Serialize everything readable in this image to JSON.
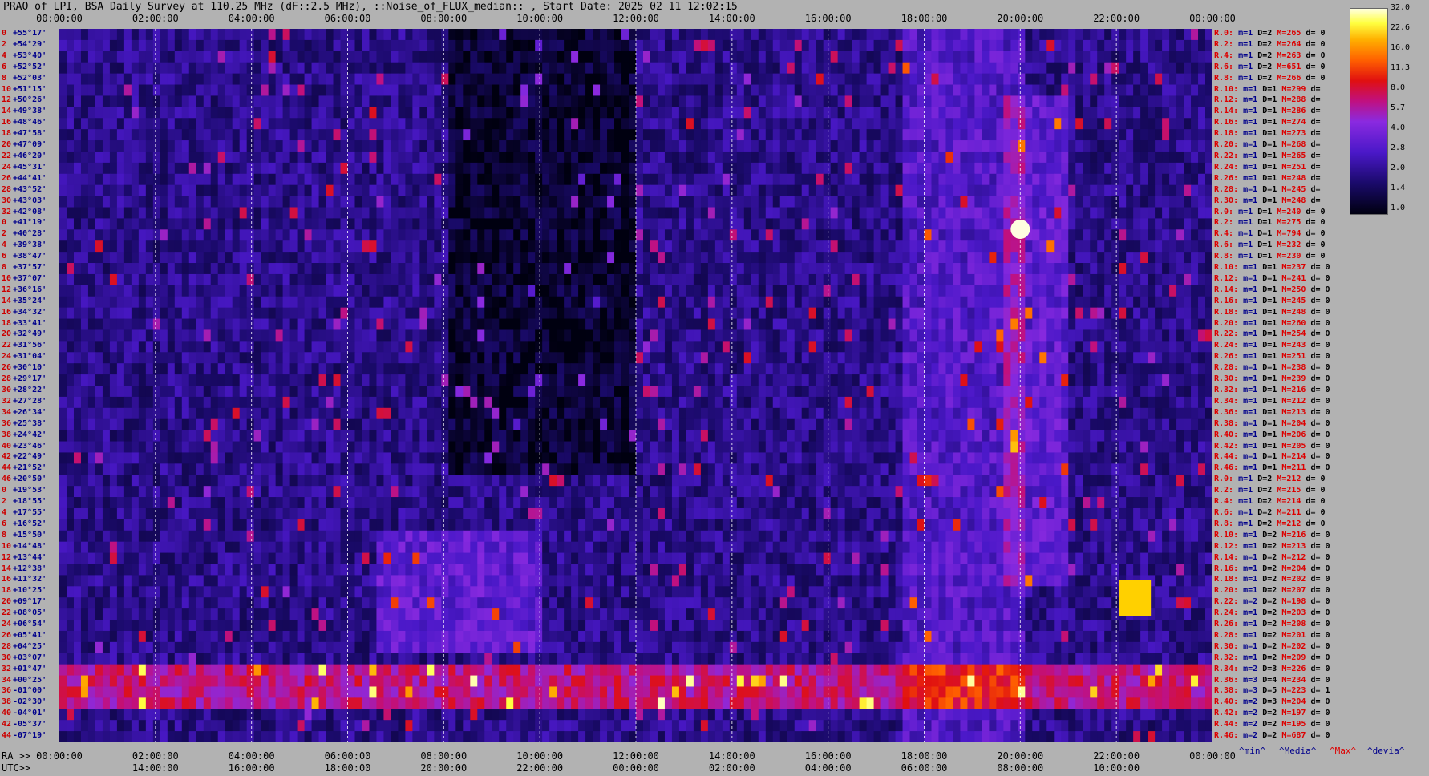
{
  "title": "PRAO of LPI, BSA Daily Survey at 110.25 MHz (dF::2.5 MHz), ::Noise_of_FLUX_median:: , Start Date: 2025 02 11 12:02:15",
  "top_axis": [
    "00:00:00",
    "02:00:00",
    "04:00:00",
    "06:00:00",
    "08:00:00",
    "10:00:00",
    "12:00:00",
    "14:00:00",
    "16:00:00",
    "18:00:00",
    "20:00:00",
    "22:00:00",
    "00:00:00"
  ],
  "bottom_ra_prefix": "RA >>",
  "bottom_ra": [
    "00:00:00",
    "02:00:00",
    "04:00:00",
    "06:00:00",
    "08:00:00",
    "10:00:00",
    "12:00:00",
    "14:00:00",
    "16:00:00",
    "18:00:00",
    "20:00:00",
    "22:00:00",
    "00:00:00"
  ],
  "bottom_utc_prefix": "UTC>>",
  "bottom_utc": [
    "14:00:00",
    "16:00:00",
    "18:00:00",
    "20:00:00",
    "22:00:00",
    "00:00:00",
    "02:00:00",
    "04:00:00",
    "06:00:00",
    "08:00:00",
    "10:00:00"
  ],
  "colorbar_ticks": [
    "32.0",
    "22.6",
    "16.0",
    "11.3",
    "8.0",
    "5.7",
    "4.0",
    "2.8",
    "2.0",
    "1.4",
    "1.0"
  ],
  "legend": {
    "min": "^min^",
    "media": "^Media^",
    "max": "^Max^",
    "devia": "^devia^"
  },
  "colors": {
    "background": "#b2b2b2",
    "label_red": "#dd0000",
    "label_blue": "#00008b"
  },
  "chart_data": {
    "type": "heatmap",
    "title": "PRAO of LPI, BSA Daily Survey at 110.25 MHz (dF::2.5 MHz), ::Noise_of_FLUX_median:: , Start Date: 2025 02 11 12:02:15",
    "x_axis_top": "local time",
    "x_range_hours": [
      0,
      24
    ],
    "color_scale_range": [
      1.0,
      32.0
    ],
    "declinations": [
      "+55°17'",
      "+54°29'",
      "+53°40'",
      "+52°52'",
      "+52°03'",
      "+51°15'",
      "+50°26'",
      "+49°38'",
      "+48°46'",
      "+47°58'",
      "+47°09'",
      "+46°20'",
      "+45°31'",
      "+44°41'",
      "+43°52'",
      "+43°03'",
      "+42°08'",
      "+41°19'",
      "+40°28'",
      "+39°38'",
      "+38°47'",
      "+37°57'",
      "+37°07'",
      "+36°16'",
      "+35°24'",
      "+34°32'",
      "+33°41'",
      "+32°49'",
      "+31°56'",
      "+31°04'",
      "+30°10'",
      "+29°17'",
      "+28°22'",
      "+27°28'",
      "+26°34'",
      "+25°38'",
      "+24°42'",
      "+23°46'",
      "+22°49'",
      "+21°52'",
      "+20°50'",
      "+19°53'",
      "+18°55'",
      "+17°55'",
      "+16°52'",
      "+15°50'",
      "+14°48'",
      "+13°44'",
      "+12°38'",
      "+11°32'",
      "+10°25'",
      "+09°17'",
      "+08°05'",
      "+06°54'",
      "+05°41'",
      "+04°25'",
      "+03°07'",
      "+01°47'",
      "+00°25'",
      "-01°00'",
      "-02°30'",
      "-04°01'",
      "-05°37'",
      "-07°19'"
    ],
    "row_index": [
      "0",
      "2",
      "4",
      "6",
      "8",
      "10",
      "12",
      "14",
      "16",
      "18",
      "20",
      "22",
      "24",
      "26",
      "28",
      "30",
      "32",
      "0",
      "2",
      "4",
      "6",
      "8",
      "10",
      "12",
      "14",
      "16",
      "18",
      "20",
      "22",
      "24",
      "26",
      "28",
      "30",
      "32",
      "34",
      "36",
      "38",
      "40",
      "42",
      "44",
      "46",
      "0",
      "2",
      "4",
      "6",
      "8",
      "10",
      "12",
      "14",
      "16",
      "18",
      "20",
      "22",
      "24",
      "26",
      "28",
      "30",
      "32",
      "34",
      "36",
      "38",
      "40",
      "42",
      "44"
    ],
    "right_labels": [
      [
        "R.0:",
        "m=1",
        "D=2",
        "M=265",
        "d= 0"
      ],
      [
        "R.2:",
        "m=1",
        "D=2",
        "M=264",
        "d= 0"
      ],
      [
        "R.4:",
        "m=1",
        "D=2",
        "M=263",
        "d= 0"
      ],
      [
        "R.6:",
        "m=1",
        "D=2",
        "M=651",
        "d= 0"
      ],
      [
        "R.8:",
        "m=1",
        "D=2",
        "M=266",
        "d= 0"
      ],
      [
        "R.10:",
        "m=1",
        "D=1",
        "M=299",
        "d="
      ],
      [
        "R.12:",
        "m=1",
        "D=1",
        "M=288",
        "d="
      ],
      [
        "R.14:",
        "m=1",
        "D=1",
        "M=286",
        "d="
      ],
      [
        "R.16:",
        "m=1",
        "D=1",
        "M=274",
        "d="
      ],
      [
        "R.18:",
        "m=1",
        "D=1",
        "M=273",
        "d="
      ],
      [
        "R.20:",
        "m=1",
        "D=1",
        "M=268",
        "d="
      ],
      [
        "R.22:",
        "m=1",
        "D=1",
        "M=265",
        "d="
      ],
      [
        "R.24:",
        "m=1",
        "D=1",
        "M=251",
        "d="
      ],
      [
        "R.26:",
        "m=1",
        "D=1",
        "M=248",
        "d="
      ],
      [
        "R.28:",
        "m=1",
        "D=1",
        "M=245",
        "d="
      ],
      [
        "R.30:",
        "m=1",
        "D=1",
        "M=248",
        "d="
      ],
      [
        "R.0:",
        "m=1",
        "D=1",
        "M=240",
        "d= 0"
      ],
      [
        "R.2:",
        "m=1",
        "D=1",
        "M=275",
        "d= 0"
      ],
      [
        "R.4:",
        "m=1",
        "D=1",
        "M=794",
        "d= 0"
      ],
      [
        "R.6:",
        "m=1",
        "D=1",
        "M=232",
        "d= 0"
      ],
      [
        "R.8:",
        "m=1",
        "D=1",
        "M=230",
        "d= 0"
      ],
      [
        "R.10:",
        "m=1",
        "D=1",
        "M=237",
        "d= 0"
      ],
      [
        "R.12:",
        "m=1",
        "D=1",
        "M=241",
        "d= 0"
      ],
      [
        "R.14:",
        "m=1",
        "D=1",
        "M=250",
        "d= 0"
      ],
      [
        "R.16:",
        "m=1",
        "D=1",
        "M=245",
        "d= 0"
      ],
      [
        "R.18:",
        "m=1",
        "D=1",
        "M=248",
        "d= 0"
      ],
      [
        "R.20:",
        "m=1",
        "D=1",
        "M=260",
        "d= 0"
      ],
      [
        "R.22:",
        "m=1",
        "D=1",
        "M=254",
        "d= 0"
      ],
      [
        "R.24:",
        "m=1",
        "D=1",
        "M=243",
        "d= 0"
      ],
      [
        "R.26:",
        "m=1",
        "D=1",
        "M=251",
        "d= 0"
      ],
      [
        "R.28:",
        "m=1",
        "D=1",
        "M=238",
        "d= 0"
      ],
      [
        "R.30:",
        "m=1",
        "D=1",
        "M=239",
        "d= 0"
      ],
      [
        "R.32:",
        "m=1",
        "D=1",
        "M=216",
        "d= 0"
      ],
      [
        "R.34:",
        "m=1",
        "D=1",
        "M=212",
        "d= 0"
      ],
      [
        "R.36:",
        "m=1",
        "D=1",
        "M=213",
        "d= 0"
      ],
      [
        "R.38:",
        "m=1",
        "D=1",
        "M=204",
        "d= 0"
      ],
      [
        "R.40:",
        "m=1",
        "D=1",
        "M=206",
        "d= 0"
      ],
      [
        "R.42:",
        "m=1",
        "D=1",
        "M=205",
        "d= 0"
      ],
      [
        "R.44:",
        "m=1",
        "D=1",
        "M=214",
        "d= 0"
      ],
      [
        "R.46:",
        "m=1",
        "D=1",
        "M=211",
        "d= 0"
      ],
      [
        "R.0:",
        "m=1",
        "D=2",
        "M=212",
        "d= 0"
      ],
      [
        "R.2:",
        "m=1",
        "D=2",
        "M=215",
        "d= 0"
      ],
      [
        "R.4:",
        "m=1",
        "D=2",
        "M=214",
        "d= 0"
      ],
      [
        "R.6:",
        "m=1",
        "D=2",
        "M=211",
        "d= 0"
      ],
      [
        "R.8:",
        "m=1",
        "D=2",
        "M=212",
        "d= 0"
      ],
      [
        "R.10:",
        "m=1",
        "D=2",
        "M=216",
        "d= 0"
      ],
      [
        "R.12:",
        "m=1",
        "D=2",
        "M=213",
        "d= 0"
      ],
      [
        "R.14:",
        "m=1",
        "D=2",
        "M=212",
        "d= 0"
      ],
      [
        "R.16:",
        "m=1",
        "D=2",
        "M=204",
        "d= 0"
      ],
      [
        "R.18:",
        "m=1",
        "D=2",
        "M=202",
        "d= 0"
      ],
      [
        "R.20:",
        "m=1",
        "D=2",
        "M=207",
        "d= 0"
      ],
      [
        "R.22:",
        "m=2",
        "D=2",
        "M=198",
        "d= 0"
      ],
      [
        "R.24:",
        "m=1",
        "D=2",
        "M=203",
        "d= 0"
      ],
      [
        "R.26:",
        "m=1",
        "D=2",
        "M=208",
        "d= 0"
      ],
      [
        "R.28:",
        "m=1",
        "D=2",
        "M=201",
        "d= 0"
      ],
      [
        "R.30:",
        "m=1",
        "D=2",
        "M=202",
        "d= 0"
      ],
      [
        "R.32:",
        "m=1",
        "D=2",
        "M=209",
        "d= 0"
      ],
      [
        "R.34:",
        "m=2",
        "D=3",
        "M=226",
        "d= 0"
      ],
      [
        "R.36:",
        "m=3",
        "D=4",
        "M=234",
        "d= 0"
      ],
      [
        "R.38:",
        "m=3",
        "D=5",
        "M=223",
        "d= 1"
      ],
      [
        "R.40:",
        "m=2",
        "D=3",
        "M=204",
        "d= 0"
      ],
      [
        "R.42:",
        "m=2",
        "D=2",
        "M=197",
        "d= 0"
      ],
      [
        "R.44:",
        "m=2",
        "D=2",
        "M=195",
        "d= 0"
      ],
      [
        "R.46:",
        "m=2",
        "D=2",
        "M=687",
        "d= 0"
      ]
    ]
  }
}
